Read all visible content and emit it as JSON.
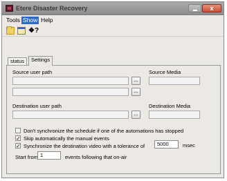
{
  "window": {
    "title": "Etere Disaster Recovery",
    "close_glyph": "x"
  },
  "menu": {
    "items": [
      {
        "label": "Tools"
      },
      {
        "label": "Show"
      },
      {
        "label": "Help"
      }
    ],
    "active": "Show"
  },
  "toolbar": {
    "help_glyph": "❖?"
  },
  "tabs": {
    "items": [
      {
        "label": "status"
      },
      {
        "label": "Settings"
      }
    ],
    "selected": "Settings"
  },
  "settings": {
    "source_user_path_label": "Source user path",
    "source_media_label": "Source Media",
    "destination_user_path_label": "Destination user path",
    "destination_media_label": "Destination Media",
    "browse_label": "...",
    "source_user_path_1": "",
    "source_user_path_2": "",
    "source_media_value": "",
    "destination_user_path_value": "",
    "destination_media_value": "",
    "options": [
      {
        "label": "Don't synchronize the schedule if one of the automations has stopped",
        "checked": false
      },
      {
        "label": "Skip automatically the manual events",
        "checked": true
      },
      {
        "label": "Synchronize the destination video with a tolerance of",
        "checked": true
      }
    ],
    "tolerance_value": "5000",
    "tolerance_unit": "msec",
    "start_from_label": "Start from",
    "start_from_value": "1",
    "events_following_label": "events following that on-air"
  }
}
